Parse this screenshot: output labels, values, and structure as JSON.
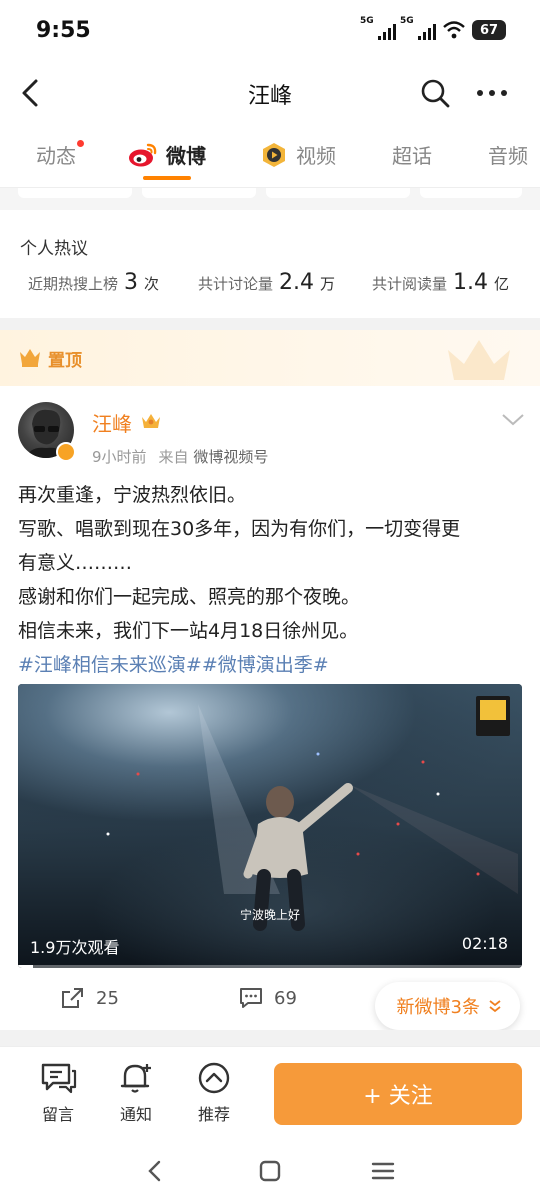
{
  "status_bar": {
    "time": "9:55",
    "network1": "5G",
    "network2": "5G",
    "battery": "67"
  },
  "header": {
    "title": "汪峰"
  },
  "tabs": [
    {
      "label": "动态",
      "has_dot": true
    },
    {
      "label": "微博",
      "active": true
    },
    {
      "label": "视频"
    },
    {
      "label": "超话"
    },
    {
      "label": "音频"
    }
  ],
  "heat": {
    "title": "个人热议",
    "stats": [
      {
        "label": "近期热搜上榜",
        "value": "3",
        "unit": "次"
      },
      {
        "label": "共计讨论量",
        "value": "2.4",
        "unit": "万"
      },
      {
        "label": "共计阅读量",
        "value": "1.4",
        "unit": "亿"
      }
    ]
  },
  "post": {
    "pinned_label": "置顶",
    "author": "汪峰",
    "time": "9小时前",
    "source_prefix": "来自",
    "source": "微博视频号",
    "lines": [
      "再次重逢，宁波热烈依旧。",
      "写歌、唱歌到现在30多年，因为有你们，一切变得更",
      "有意义………",
      "感谢和你们一起完成、照亮的那个夜晚。",
      "相信未来，我们下一站4月18日徐州见。"
    ],
    "hashtags": "#汪峰相信未来巡演##微博演出季#",
    "video": {
      "subtitle": "宁波晚上好",
      "views": "1.9万次观看",
      "duration": "02:18",
      "progress": 0.03
    },
    "reposts": "25",
    "comments": "69",
    "new_posts": "新微博3条"
  },
  "bottom_bar": {
    "comment": "留言",
    "notify": "通知",
    "recommend": "推荐",
    "follow": "+ 关注"
  },
  "colors": {
    "accent": "#f08020",
    "follow_bg": "#f69a3a",
    "link": "#5b80b4"
  }
}
